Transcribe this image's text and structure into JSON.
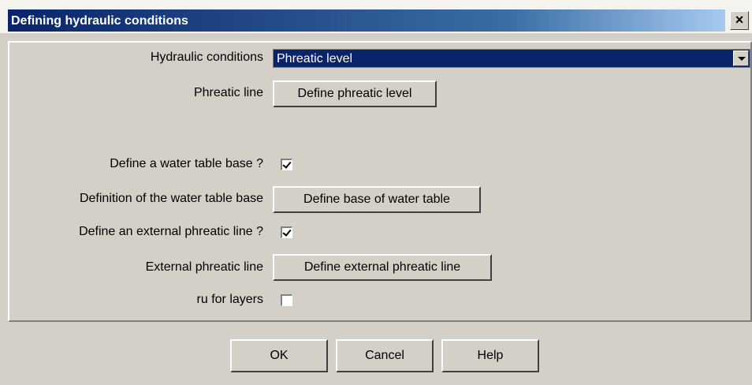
{
  "window": {
    "title": "Defining hydraulic conditions",
    "close_glyph": "×",
    "close_icon": "close-icon"
  },
  "form": {
    "hydraulic_conditions_label": "Hydraulic conditions",
    "hydraulic_conditions_value": "Phreatic level",
    "phreatic_line_label": "Phreatic line",
    "phreatic_line_button": "Define phreatic level",
    "water_table_base_question": "Define a water table base ?",
    "water_table_base_checked": true,
    "water_table_base_def_label": "Definition of the water table base",
    "water_table_base_button": "Define base of water table",
    "external_phreatic_question": "Define an external phreatic line ?",
    "external_phreatic_checked": true,
    "external_phreatic_label": "External phreatic line",
    "external_phreatic_button": "Define external phreatic line",
    "ru_layers_label": "ru for layers",
    "ru_layers_checked": false
  },
  "footer": {
    "ok_label": "OK",
    "cancel_label": "Cancel",
    "help_label": "Help"
  },
  "colors": {
    "dialog_bg": "#d4d0c8",
    "title_blue": "#0a246a",
    "selection_blue": "#0a246a"
  }
}
